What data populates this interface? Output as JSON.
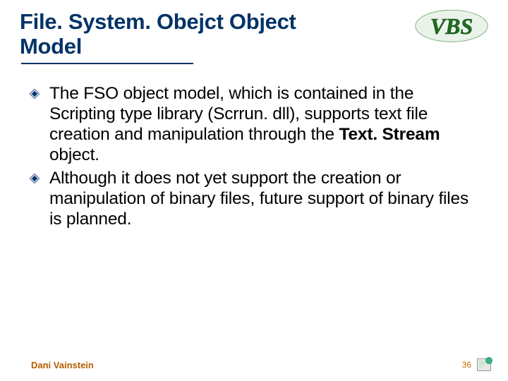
{
  "header": {
    "title": "File. System. Obejct Object Model"
  },
  "bullets": [
    {
      "prefix": "The FSO object model, which is contained in the Scripting type library (Scrrun. dll), supports text file creation and manipulation through the ",
      "bold": "Text. Stream",
      "suffix": " object."
    },
    {
      "prefix": "Although it does not yet support the creation or manipulation of binary files, future support of binary files is planned.",
      "bold": "",
      "suffix": ""
    }
  ],
  "footer": {
    "author": "Dani Vainstein",
    "page": "36"
  },
  "logo": {
    "text": "VBS"
  }
}
